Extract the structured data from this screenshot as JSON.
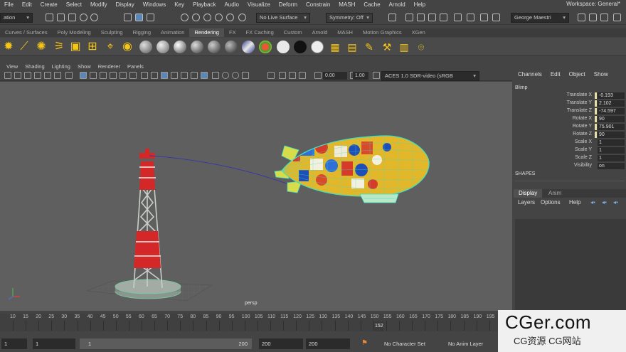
{
  "menubar": {
    "items": [
      "File",
      "Edit",
      "Create",
      "Select",
      "Modify",
      "Display",
      "Windows",
      "Key",
      "Playback",
      "Audio",
      "Visualize",
      "Deform",
      "Constrain",
      "MASH",
      "Cache",
      "Arnold",
      "Help"
    ],
    "workspace_label": "Workspace:",
    "workspace_value": "General*"
  },
  "statusline": {
    "mode_value": "ation",
    "live_surface": "No Live Surface",
    "symmetry": "Symmetry: Off",
    "user": "George Maestri"
  },
  "shelf_tabs": {
    "items": [
      "Curves / Surfaces",
      "Poly Modeling",
      "Sculpting",
      "Rigging",
      "Animation",
      "Rendering",
      "FX",
      "FX Caching",
      "Custom",
      "Arnold",
      "MASH",
      "Motion Graphics",
      "XGen"
    ],
    "active": "Rendering"
  },
  "panel": {
    "menu": [
      "View",
      "Shading",
      "Lighting",
      "Show",
      "Renderer",
      "Panels"
    ],
    "field1": "0.00",
    "field2": "1.00",
    "color_space": "ACES 1.0 SDR-video (sRGB"
  },
  "viewport": {
    "camera": "persp"
  },
  "channel_box": {
    "menu": [
      "Channels",
      "Edit",
      "Object",
      "Show"
    ],
    "object": "Blimp",
    "attributes": [
      {
        "label": "Translate X",
        "value": "-0.193"
      },
      {
        "label": "Translate Y",
        "value": "2.102"
      },
      {
        "label": "Translate Z",
        "value": "-74.597"
      },
      {
        "label": "Rotate X",
        "value": "90"
      },
      {
        "label": "Rotate Y",
        "value": "75.901"
      },
      {
        "label": "Rotate Z",
        "value": "90"
      },
      {
        "label": "Scale X",
        "value": "1"
      },
      {
        "label": "Scale Y",
        "value": "1"
      },
      {
        "label": "Scale Z",
        "value": "1"
      },
      {
        "label": "Visibility",
        "value": "on"
      }
    ],
    "shapes_label": "SHAPES"
  },
  "layer_editor": {
    "tabs": [
      "Display",
      "Anim"
    ],
    "active_tab": "Display",
    "menu": [
      "Layers",
      "Options",
      "Help"
    ]
  },
  "timeslider": {
    "ticks": [
      "10",
      "15",
      "20",
      "25",
      "30",
      "35",
      "40",
      "45",
      "50",
      "55",
      "60",
      "65",
      "70",
      "75",
      "80",
      "85",
      "90",
      "95",
      "100",
      "105",
      "110",
      "115",
      "120",
      "125",
      "130",
      "135",
      "140",
      "145",
      "150",
      "155",
      "160",
      "165",
      "170",
      "175",
      "180",
      "185",
      "190",
      "195"
    ],
    "current_frame": "152"
  },
  "range": {
    "start": "1",
    "inner_start": "1",
    "inner_end": "200",
    "end": "200",
    "end2": "200",
    "character_set": "No Character Set",
    "anim_layer": "No Anim Layer"
  },
  "watermark": {
    "main": "CGer.com",
    "sub": "CG资源 CG网站"
  }
}
